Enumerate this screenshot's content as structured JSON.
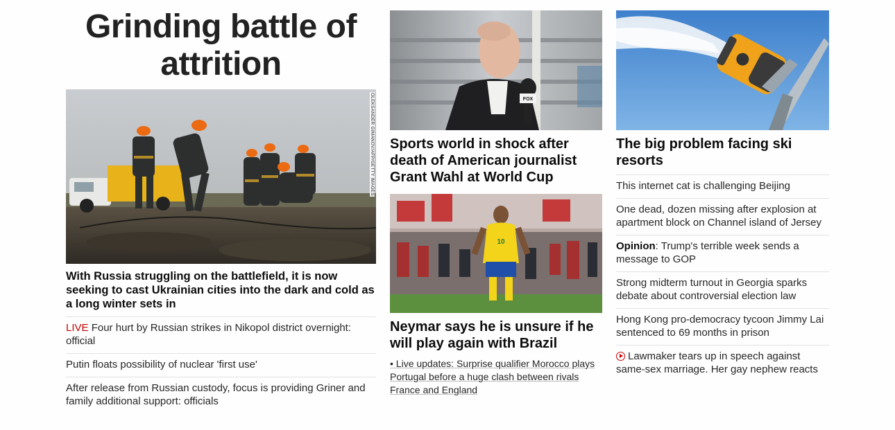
{
  "hero": {
    "headline": "Grinding battle of attrition",
    "image_alt": "Utility workers in hard hats repairing cables in a muddy field",
    "image_credit": "OLEKSANDER GIMANOV/AFP/GETTY IMAGES",
    "caption": "With Russia struggling on the battlefield, it is now seeking to cast Ukrainian cities into the dark and cold as a long winter sets in",
    "items": [
      {
        "prefix": "LIVE",
        "text": "Four hurt by Russian strikes in Nikopol district overnight: official"
      },
      {
        "text": "Putin floats possibility of nuclear 'first use'"
      },
      {
        "text": "After release from Russian custody, focus is providing Griner and family additional support: officials"
      }
    ]
  },
  "middle": {
    "story1": {
      "image_alt": "Sports journalist holding a FOX microphone",
      "title": "Sports world in shock after death of American journalist Grant Wahl at World Cup"
    },
    "story2": {
      "image_alt": "Neymar standing on the pitch with hands on hips",
      "title": "Neymar says he is unsure if he will play again with Brazil",
      "link": "• Live updates: Surprise qualifier Morocco plays Portugal before a huge clash between rivals France and England"
    }
  },
  "right": {
    "image_alt": "Snow cannon spraying snow against blue sky",
    "title": "The big problem facing ski resorts",
    "items": [
      {
        "text": "This internet cat is challenging Beijing"
      },
      {
        "text": "One dead, dozen missing after explosion at apartment block on Channel island of Jersey"
      },
      {
        "prefix": "Opinion",
        "text": ": Trump's terrible week sends a message to GOP"
      },
      {
        "text": "Strong midterm turnout in Georgia sparks debate about controversial election law"
      },
      {
        "text": "Hong Kong pro-democracy tycoon Jimmy Lai sentenced to 69 months in prison"
      },
      {
        "icon": "play-icon",
        "text": "Lawmaker tears up in speech against same-sex marriage. Her gay nephew reacts"
      }
    ]
  },
  "colors": {
    "live_red": "#cc0000",
    "text": "#0c0c0c",
    "divider": "#e2e2e2"
  }
}
